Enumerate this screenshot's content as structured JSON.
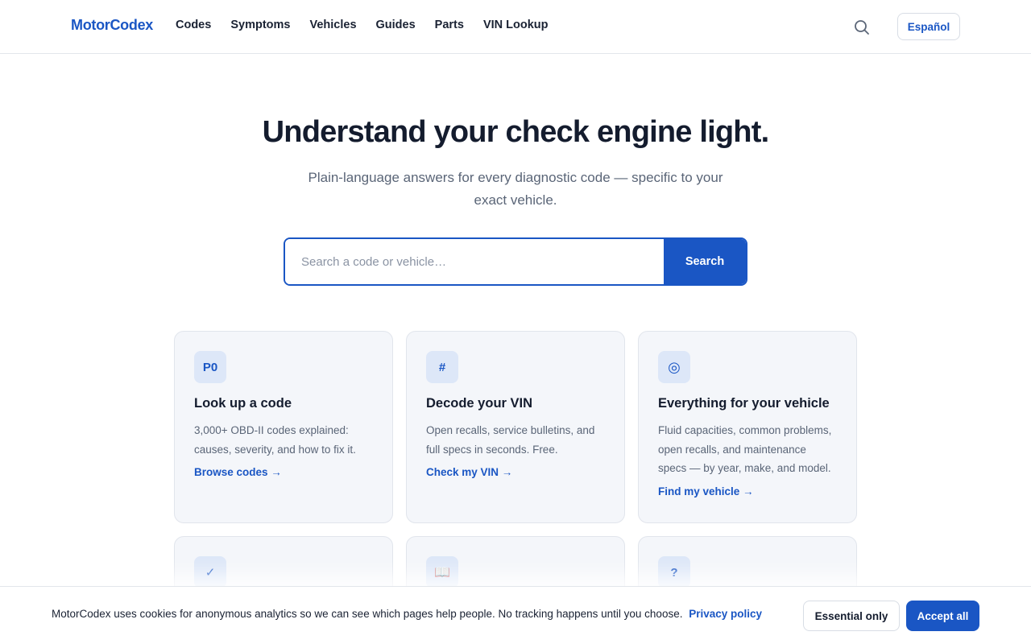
{
  "header": {
    "logo": "MotorCodex",
    "nav": [
      "Codes",
      "Symptoms",
      "Vehicles",
      "Guides",
      "Parts",
      "VIN Lookup"
    ],
    "search_icon": "search-icon",
    "language_label": "Español"
  },
  "hero": {
    "title": "Understand your check engine light.",
    "subtitle": "Plain-language answers for every diagnostic code — specific to your exact vehicle.",
    "search_placeholder": "Search a code or vehicle…",
    "search_value": "",
    "search_button": "Search"
  },
  "cards": [
    {
      "badge": "P0",
      "title": "Look up a code",
      "desc": "3,000+ OBD-II codes explained: causes, severity, and how to fix it.",
      "link": "Browse codes →"
    },
    {
      "badge": "#",
      "title": "Decode your VIN",
      "desc": "Open recalls, service bulletins, and full specs in seconds. Free.",
      "link": "Check my VIN →"
    },
    {
      "badge": "◎",
      "title": "Everything for your vehicle",
      "desc": "Fluid capacities, common problems, open recalls, and maintenance specs — by year, make, and model.",
      "link": "Find my vehicle →"
    },
    {
      "badge": "✓"
    },
    {
      "badge": "📖"
    },
    {
      "badge": "?"
    }
  ],
  "cookie": {
    "text": "MotorCodex uses cookies for anonymous analytics so we can see which pages help people. No tracking happens until you choose.",
    "policy_link": "Privacy policy",
    "essential_button": "Essential only",
    "accept_button": "Accept all"
  },
  "colors": {
    "accent": "#1a56c4",
    "card_bg": "#f4f6fa",
    "badge_bg": "#dde7f8",
    "text_dark": "#141c2e",
    "text_muted": "#5a6577"
  }
}
